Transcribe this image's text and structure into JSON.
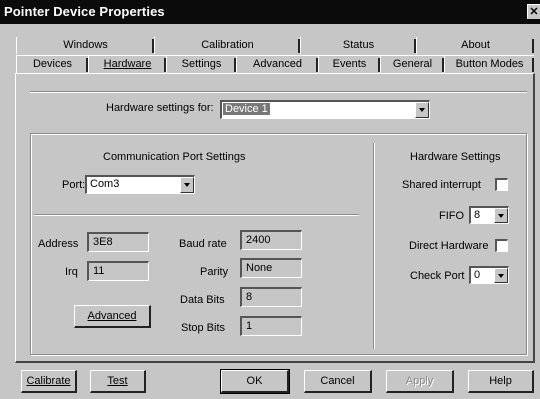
{
  "window": {
    "title": "Pointer Device Properties",
    "close_glyph": "✕"
  },
  "tabs": {
    "row_top": [
      "Windows",
      "Calibration",
      "Status",
      "About"
    ],
    "row_bottom": [
      "Devices",
      "Hardware",
      "Settings",
      "Advanced",
      "Events",
      "General",
      "Button Modes"
    ],
    "active": "Hardware"
  },
  "hardware_for": {
    "label": "Hardware settings for:",
    "value": "Device 1"
  },
  "comm_port": {
    "heading": "Communication Port Settings",
    "port_label": "Port:",
    "port_value": "Com3"
  },
  "hardware_settings": {
    "heading": "Hardware Settings",
    "shared_interrupt_label": "Shared interrupt",
    "shared_interrupt_checked": false,
    "fifo_label": "FIFO",
    "fifo_value": "8",
    "direct_hardware_label": "Direct Hardware",
    "direct_hardware_checked": false,
    "check_port_label": "Check Port",
    "check_port_value": "0"
  },
  "port_details": {
    "address_label": "Address",
    "address_value": "3E8",
    "irq_label": "Irq",
    "irq_value": "11",
    "advanced_button": "Advanced",
    "baud_label": "Baud rate",
    "baud_value": "2400",
    "parity_label": "Parity",
    "parity_value": "None",
    "data_bits_label": "Data Bits",
    "data_bits_value": "8",
    "stop_bits_label": "Stop Bits",
    "stop_bits_value": "1"
  },
  "buttons": {
    "calibrate": "Calibrate",
    "test": "Test",
    "ok": "OK",
    "cancel": "Cancel",
    "apply": "Apply",
    "help": "Help"
  }
}
